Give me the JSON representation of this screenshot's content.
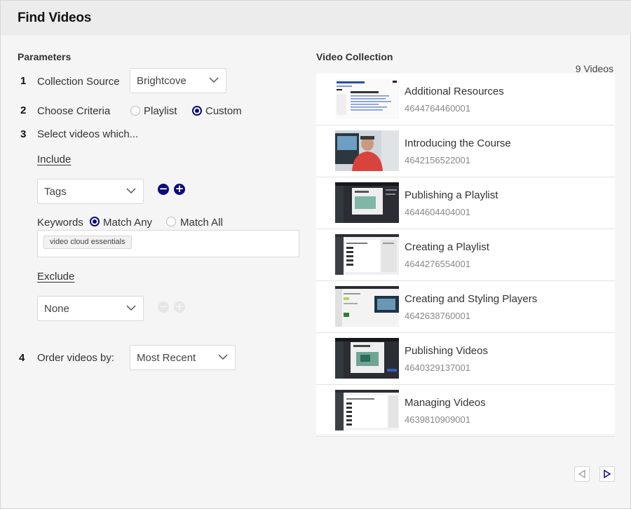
{
  "window": {
    "title": "Find Videos"
  },
  "parameters": {
    "heading": "Parameters",
    "step1": {
      "num": "1",
      "label": "Collection Source",
      "value": "Brightcove"
    },
    "step2": {
      "num": "2",
      "label": "Choose Criteria",
      "options": [
        {
          "label": "Playlist",
          "selected": false
        },
        {
          "label": "Custom",
          "selected": true
        }
      ]
    },
    "step3": {
      "num": "3",
      "label": "Select videos which..."
    },
    "include": {
      "label": "Include",
      "field": "Tags",
      "remove_icon": "minus-circle-icon",
      "add_icon": "plus-circle-icon",
      "keywords_label": "Keywords",
      "match_options": [
        {
          "label": "Match Any",
          "selected": true
        },
        {
          "label": "Match All",
          "selected": false
        }
      ],
      "tags": [
        "video cloud essentials"
      ]
    },
    "exclude": {
      "label": "Exclude",
      "field": "None"
    },
    "step4": {
      "num": "4",
      "label": "Order videos by:",
      "value": "Most Recent"
    }
  },
  "collection": {
    "heading": "Video Collection",
    "count": "9 Videos",
    "videos": [
      {
        "title": "Additional Resources",
        "id": "4644764460001",
        "thumb": "document"
      },
      {
        "title": "Introducing the Course",
        "id": "4642156522001",
        "thumb": "presenter"
      },
      {
        "title": "Publishing a Playlist",
        "id": "4644604404001",
        "thumb": "dark-ui"
      },
      {
        "title": "Creating a Playlist",
        "id": "4644276554001",
        "thumb": "list-ui"
      },
      {
        "title": "Creating and Styling Players",
        "id": "4642638760001",
        "thumb": "player-ui"
      },
      {
        "title": "Publishing Videos",
        "id": "4640329137001",
        "thumb": "dark-ui"
      },
      {
        "title": "Managing Videos",
        "id": "4639810909001",
        "thumb": "list-ui"
      }
    ]
  },
  "pager": {
    "prev_icon": "triangle-left-icon",
    "next_icon": "triangle-right-icon"
  },
  "colors": {
    "accent": "#0a0a7a",
    "panel": "#ffffff",
    "background": "#f5f5f5"
  }
}
